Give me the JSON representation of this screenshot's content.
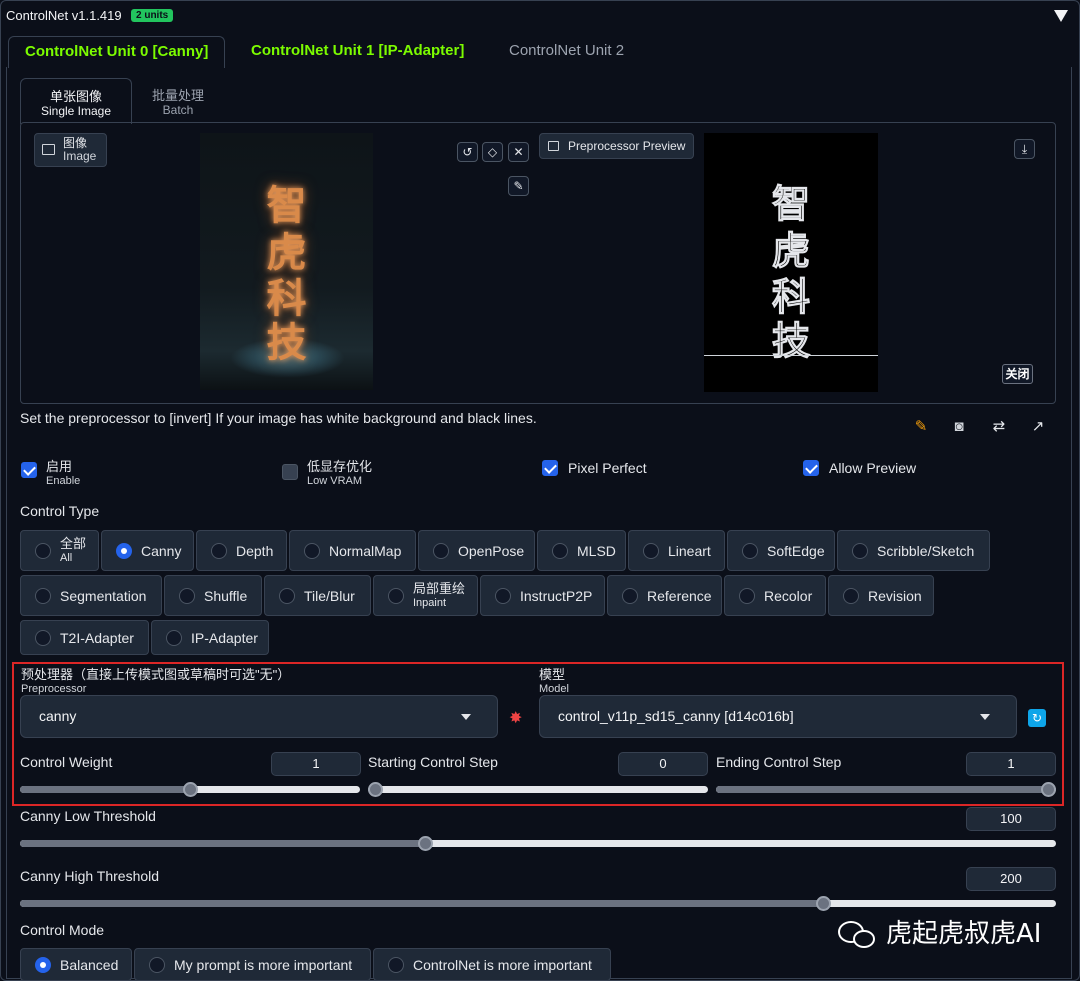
{
  "header": {
    "title": "ControlNet v1.1.419",
    "badge": "2 units"
  },
  "unit_tabs": [
    {
      "label": "ControlNet Unit 0 [Canny]"
    },
    {
      "label": "ControlNet Unit 1 [IP-Adapter]"
    },
    {
      "label": "ControlNet Unit 2"
    }
  ],
  "sub_tabs": [
    {
      "zh": "单张图像",
      "en": "Single Image"
    },
    {
      "zh": "批量处理",
      "en": "Batch"
    }
  ],
  "image_panel": {
    "label_zh": "图像",
    "label_en": "Image",
    "chars": [
      "智",
      "虎",
      "科",
      "技"
    ]
  },
  "preprocessor_preview": {
    "label": "Preprocessor Preview",
    "close": "关闭"
  },
  "hint": "Set the preprocessor to [invert] If your image has white background and black lines.",
  "checkboxes": {
    "enable": {
      "zh": "启用",
      "en": "Enable",
      "checked": true
    },
    "low_vram": {
      "zh": "低显存优化",
      "en": "Low VRAM",
      "checked": false
    },
    "pixel_perfect": {
      "label": "Pixel Perfect",
      "checked": true
    },
    "allow_preview": {
      "label": "Allow Preview",
      "checked": true
    }
  },
  "control_type": {
    "label": "Control Type",
    "selected": "Canny",
    "options": [
      {
        "zh": "全部",
        "en": "All"
      },
      {
        "label": "Canny"
      },
      {
        "label": "Depth"
      },
      {
        "label": "NormalMap"
      },
      {
        "label": "OpenPose"
      },
      {
        "label": "MLSD"
      },
      {
        "label": "Lineart"
      },
      {
        "label": "SoftEdge"
      },
      {
        "label": "Scribble/Sketch"
      },
      {
        "label": "Segmentation"
      },
      {
        "label": "Shuffle"
      },
      {
        "label": "Tile/Blur"
      },
      {
        "zh": "局部重绘",
        "en": "Inpaint"
      },
      {
        "label": "InstructP2P"
      },
      {
        "label": "Reference"
      },
      {
        "label": "Recolor"
      },
      {
        "label": "Revision"
      },
      {
        "label": "T2I-Adapter"
      },
      {
        "label": "IP-Adapter"
      }
    ]
  },
  "preprocessor": {
    "label_zh": "预处理器（直接上传模式图或草稿时可选\"无\"）",
    "label_en": "Preprocessor",
    "value": "canny"
  },
  "model": {
    "label_zh": "模型",
    "label_en": "Model",
    "value": "control_v11p_sd15_canny [d14c016b]"
  },
  "sliders": {
    "control_weight": {
      "label": "Control Weight",
      "value": "1",
      "min": 0,
      "max": 2,
      "fraction": 0.5
    },
    "starting_step": {
      "label": "Starting Control Step",
      "value": "0",
      "min": 0,
      "max": 1,
      "fraction": 0
    },
    "ending_step": {
      "label": "Ending Control Step",
      "value": "1",
      "min": 0,
      "max": 1,
      "fraction": 1
    },
    "canny_low": {
      "label": "Canny Low Threshold",
      "value": "100",
      "min": 1,
      "max": 255,
      "fraction": 0.39
    },
    "canny_high": {
      "label": "Canny High Threshold",
      "value": "200",
      "min": 1,
      "max": 255,
      "fraction": 0.78
    }
  },
  "control_mode": {
    "label": "Control Mode",
    "selected": "Balanced",
    "options": [
      "Balanced",
      "My prompt is more important",
      "ControlNet is more important"
    ]
  },
  "watermark": "虎起虎叔虎AI"
}
